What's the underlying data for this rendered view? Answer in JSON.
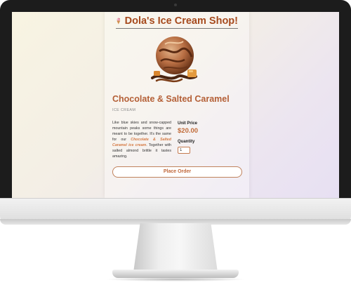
{
  "header": {
    "title": "Dola's Ice Cream Shop!",
    "logo_icon": "ice-cream-cone-icon"
  },
  "product": {
    "name": "Chocolate & Salted Caramel",
    "category": "ICE CREAM",
    "description_before": "Like blue skies and snow-capped mountain peaks some things are meant to be together. It's the same for our ",
    "description_highlight": "Chocolate & Salted Caramel ice cream",
    "description_after": ". Together with salted almond brittle it tastes amazing.",
    "unit_price_label": "Unit Price",
    "unit_price": "$20.00",
    "quantity_label": "Quantity",
    "quantity_value": "1"
  },
  "actions": {
    "place_order_label": "Place Order"
  },
  "colors": {
    "brand": "#a64a1d",
    "accent": "#c06a38",
    "bezel": "#1c1c1c"
  }
}
